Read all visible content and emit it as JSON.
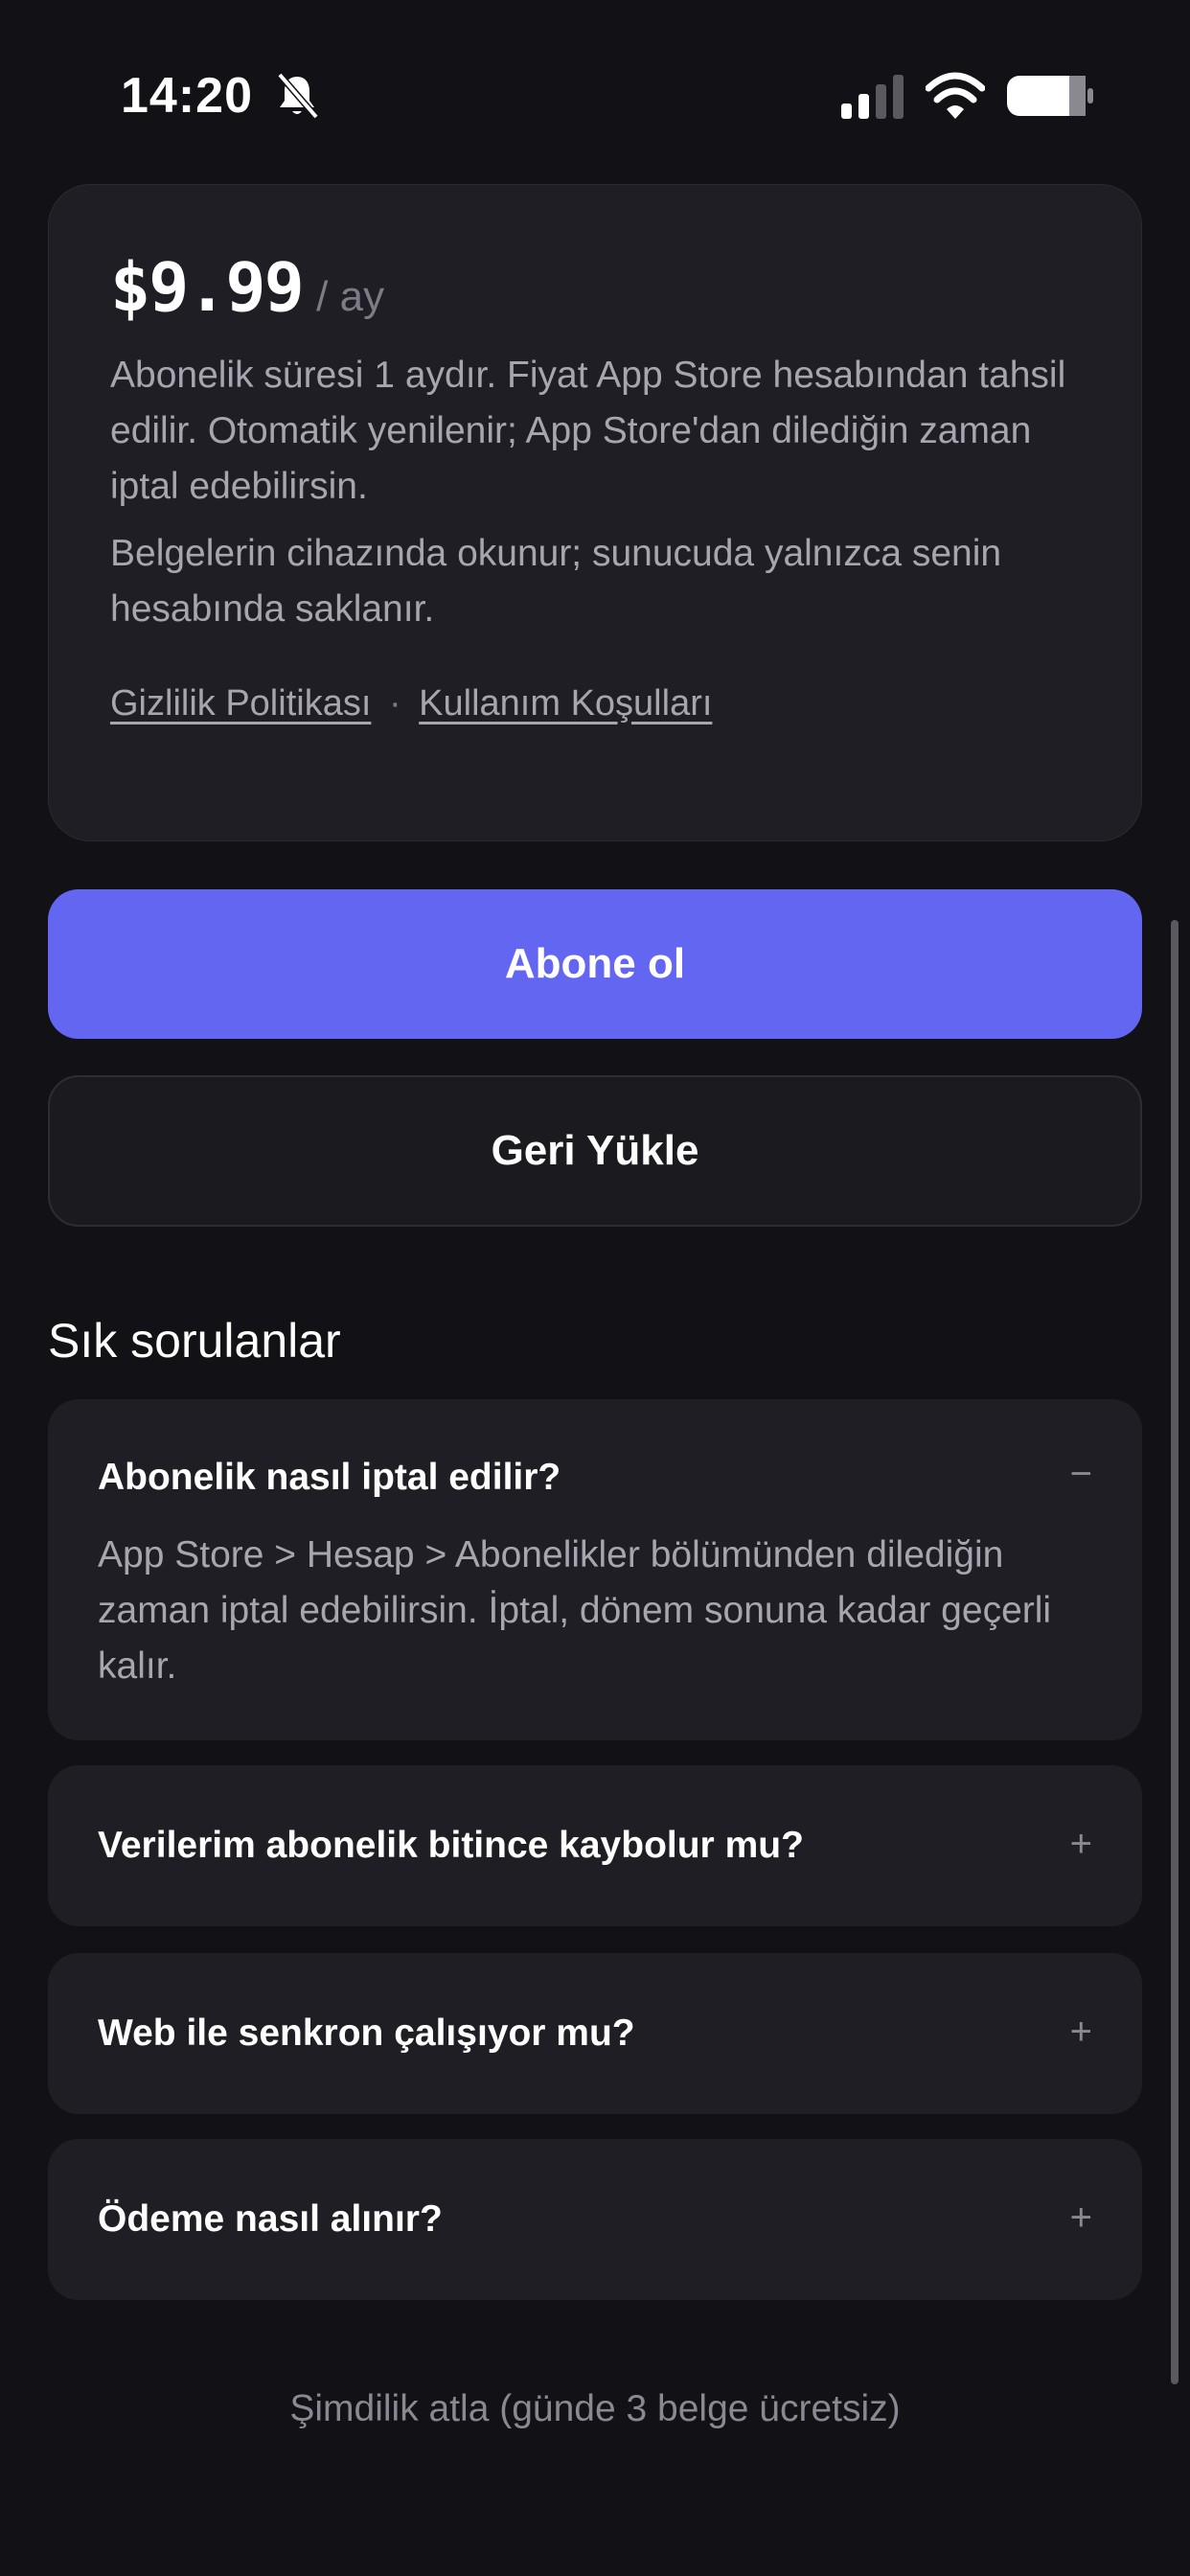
{
  "status_bar": {
    "time": "14:20"
  },
  "pricing": {
    "price": "$9.99",
    "period": "/ ay",
    "description": "Abonelik süresi 1 aydır. Fiyat App Store hesabından tahsil edilir. Otomatik yenilenir; App Store'dan dilediğin zaman iptal edebilirsin.",
    "privacy_note": "Belgelerin cihazında okunur; sunucuda yalnızca senin hesabında saklanır.",
    "privacy_link": "Gizlilik Politikası",
    "separator": "·",
    "terms_link": "Kullanım Koşulları"
  },
  "actions": {
    "subscribe_label": "Abone ol",
    "restore_label": "Geri Yükle"
  },
  "faq": {
    "title": "Sık sorulanlar",
    "items": [
      {
        "question": "Abonelik nasıl iptal edilir?",
        "answer": "App Store > Hesap > Abonelikler bölümünden dilediğin zaman iptal edebilirsin. İptal, dönem sonuna kadar geçerli kalır.",
        "toggle": "−",
        "expanded": true
      },
      {
        "question": "Verilerim abonelik bitince kaybolur mu?",
        "toggle": "+",
        "expanded": false
      },
      {
        "question": "Web ile senkron çalışıyor mu?",
        "toggle": "+",
        "expanded": false
      },
      {
        "question": "Ödeme nasıl alınır?",
        "toggle": "+",
        "expanded": false
      }
    ]
  },
  "skip_label": "Şimdilik atla (günde 3 belge ücretsiz)",
  "icons": {
    "bell": "bell-slash-icon",
    "signal": "cellular-signal-icon",
    "wifi": "wifi-icon",
    "battery": "battery-icon"
  },
  "colors": {
    "accent": "#6366F1",
    "background": "#121115",
    "card": "#1F1E24"
  }
}
